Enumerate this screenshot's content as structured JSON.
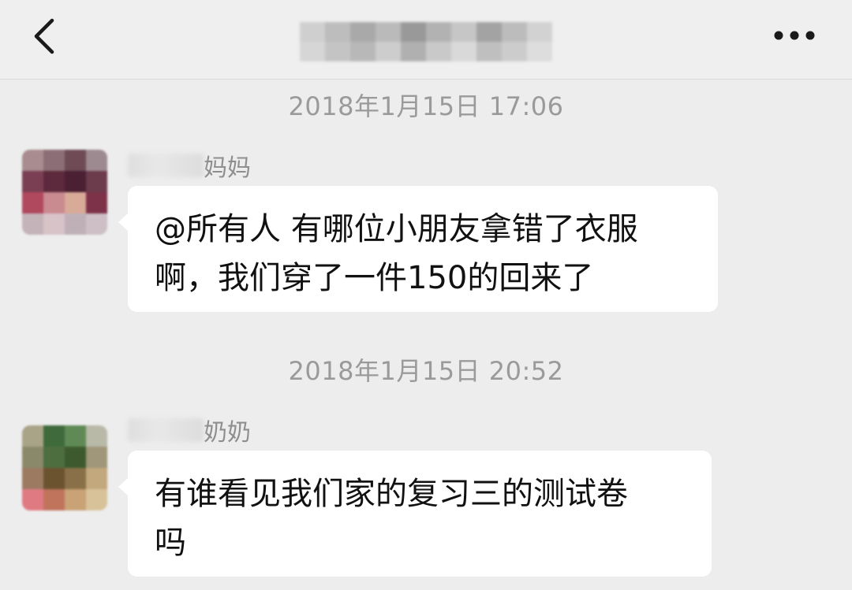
{
  "header": {
    "back_icon": "chevron-left-icon",
    "more_icon": "more-dots-icon"
  },
  "messages": [
    {
      "timestamp": "2018年1月15日 17:06",
      "sender_suffix": "妈妈",
      "line1": "@所有人 有哪位小朋友拿错了衣服",
      "line2": "啊，我们穿了一件150的回来了"
    },
    {
      "timestamp": "2018年1月15日 20:52",
      "sender_suffix": "奶奶",
      "line1": "有谁看见我们家的复习三的测试卷",
      "line2": "吗"
    }
  ]
}
